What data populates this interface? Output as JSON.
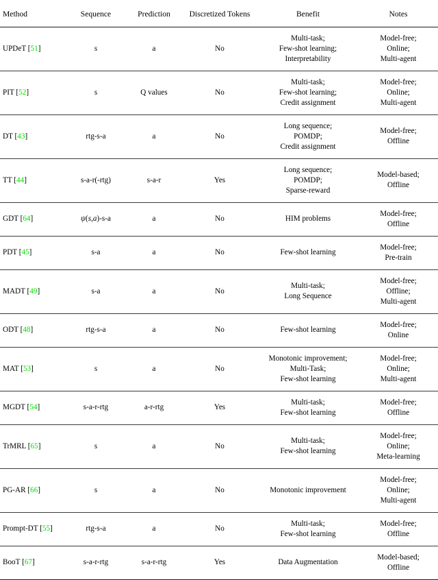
{
  "table": {
    "columns": [
      {
        "key": "method",
        "label": "Method"
      },
      {
        "key": "sequence",
        "label": "Sequence"
      },
      {
        "key": "prediction",
        "label": "Prediction"
      },
      {
        "key": "discretized",
        "label": "Discretized Tokens"
      },
      {
        "key": "benefit",
        "label": "Benefit"
      },
      {
        "key": "notes",
        "label": "Notes"
      }
    ],
    "citation_color": "#00e000",
    "rows": [
      {
        "method_name": "UPDeT",
        "citation": "51",
        "sequence": "s",
        "prediction": "a",
        "discretized": "No",
        "benefit": [
          "Multi-task;",
          "Few-shot learning;",
          "Interpretability"
        ],
        "notes": [
          "Model-free;",
          "Online;",
          "Multi-agent"
        ]
      },
      {
        "method_name": "PIT",
        "citation": "52",
        "sequence": "s",
        "prediction": "Q values",
        "discretized": "No",
        "benefit": [
          "Multi-task;",
          "Few-shot learning;",
          "Credit assignment"
        ],
        "notes": [
          "Model-free;",
          "Online;",
          "Multi-agent"
        ]
      },
      {
        "method_name": "DT",
        "citation": "43",
        "sequence": "rtg-s-a",
        "prediction": "a",
        "discretized": "No",
        "benefit": [
          "Long sequence;",
          "POMDP;",
          "Credit assignment"
        ],
        "notes": [
          "Model-free;",
          "Offline"
        ]
      },
      {
        "method_name": "TT",
        "citation": "44",
        "sequence": "s-a-r(-rtg)",
        "prediction": "s-a-r",
        "discretized": "Yes",
        "benefit": [
          "Long sequence;",
          "POMDP;",
          "Sparse-reward"
        ],
        "notes": [
          "Model-based;",
          "Offline"
        ]
      },
      {
        "method_name": "GDT",
        "citation": "64",
        "sequence": "ψ(s,a)-s-a",
        "sequence_math": true,
        "prediction": "a",
        "discretized": "No",
        "benefit": [
          "HIM problems"
        ],
        "notes": [
          "Model-free;",
          "Offline"
        ]
      },
      {
        "method_name": "PDT",
        "citation": "45",
        "sequence": "s-a",
        "prediction": "a",
        "discretized": "No",
        "benefit": [
          "Few-shot learning"
        ],
        "notes": [
          "Model-free;",
          "Pre-train"
        ]
      },
      {
        "method_name": "MADT",
        "citation": "49",
        "sequence": "s-a",
        "prediction": "a",
        "discretized": "No",
        "benefit": [
          "Multi-task;",
          "Long Sequence"
        ],
        "notes": [
          "Model-free;",
          "Offline;",
          "Multi-agent"
        ]
      },
      {
        "method_name": "ODT",
        "citation": "48",
        "sequence": "rtg-s-a",
        "prediction": "a",
        "discretized": "No",
        "benefit": [
          "Few-shot learning"
        ],
        "notes": [
          "Model-free;",
          "Online"
        ]
      },
      {
        "method_name": "MAT",
        "citation": "53",
        "sequence": "s",
        "prediction": "a",
        "discretized": "No",
        "benefit": [
          "Monotonic improvement;",
          "Multi-Task;",
          "Few-shot learning"
        ],
        "notes": [
          "Model-free;",
          "Online;",
          "Multi-agent"
        ]
      },
      {
        "method_name": "MGDT",
        "citation": "54",
        "sequence": "s-a-r-rtg",
        "prediction": "a-r-rtg",
        "discretized": "Yes",
        "benefit": [
          "Multi-task;",
          "Few-shot learning"
        ],
        "notes": [
          "Model-free;",
          "Offline"
        ]
      },
      {
        "method_name": "TrMRL",
        "citation": "65",
        "sequence": "s",
        "prediction": "a",
        "discretized": "No",
        "benefit": [
          "Multi-task;",
          "Few-shot learning"
        ],
        "notes": [
          "Model-free;",
          "Online;",
          "Meta-learning"
        ]
      },
      {
        "method_name": "PG-AR",
        "citation": "66",
        "sequence": "s",
        "prediction": "a",
        "discretized": "No",
        "benefit": [
          "Monotonic improvement"
        ],
        "notes": [
          "Model-free;",
          "Online;",
          "Multi-agent"
        ]
      },
      {
        "method_name": "Prompt-DT",
        "citation": "55",
        "sequence": "rtg-s-a",
        "prediction": "a",
        "discretized": "No",
        "benefit": [
          "Multi-task;",
          "Few-shot learning"
        ],
        "notes": [
          "Model-free;",
          "Offline"
        ]
      },
      {
        "method_name": "BooT",
        "citation": "67",
        "sequence": "s-a-r-rtg",
        "prediction": "s-a-r-rtg",
        "discretized": "Yes",
        "benefit": [
          "Data Augmentation"
        ],
        "notes": [
          "Model-based;",
          "Offline"
        ]
      }
    ]
  }
}
